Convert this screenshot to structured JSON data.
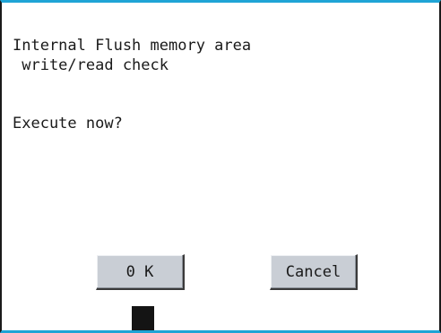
{
  "dialog": {
    "message_line1": "Internal Flush memory area",
    "message_line2": " write/read check",
    "prompt": "Execute now?"
  },
  "buttons": {
    "ok_label": "0 K",
    "cancel_label": "Cancel"
  },
  "colors": {
    "frame_accent": "#1fa4d6",
    "button_face": "#c9ced5",
    "text": "#1a1a1a"
  }
}
